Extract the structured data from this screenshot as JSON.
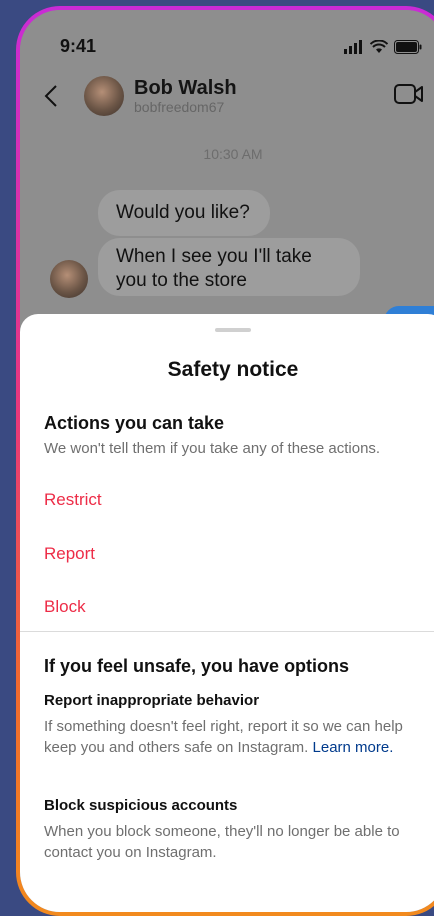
{
  "status_bar": {
    "time": "9:41"
  },
  "header": {
    "name": "Bob Walsh",
    "username": "bobfreedom67"
  },
  "chat": {
    "timestamp": "10:30 AM",
    "messages": [
      {
        "text": "Would you like?"
      },
      {
        "text": "When I see you I'll take you to the store"
      }
    ]
  },
  "sheet": {
    "title": "Safety notice",
    "actions_heading": "Actions you can take",
    "actions_desc": "We won't tell them if you take any of these actions.",
    "actions": [
      "Restrict",
      "Report",
      "Block"
    ],
    "options_heading": "If you feel unsafe, you have options",
    "report_title": "Report inappropriate behavior",
    "report_body": "If something doesn't feel right, report it so we can help keep you and others safe on Instagram.",
    "learn_more": "Learn more.",
    "block_title": "Block suspicious accounts",
    "block_body": "When you block someone, they'll no longer be able to contact you on Instagram."
  },
  "colors": {
    "action_red": "#ed2c47",
    "link_blue": "#003a8c",
    "frame_gradient": [
      "#c92bd6",
      "#e8387a",
      "#f28a1e"
    ]
  }
}
